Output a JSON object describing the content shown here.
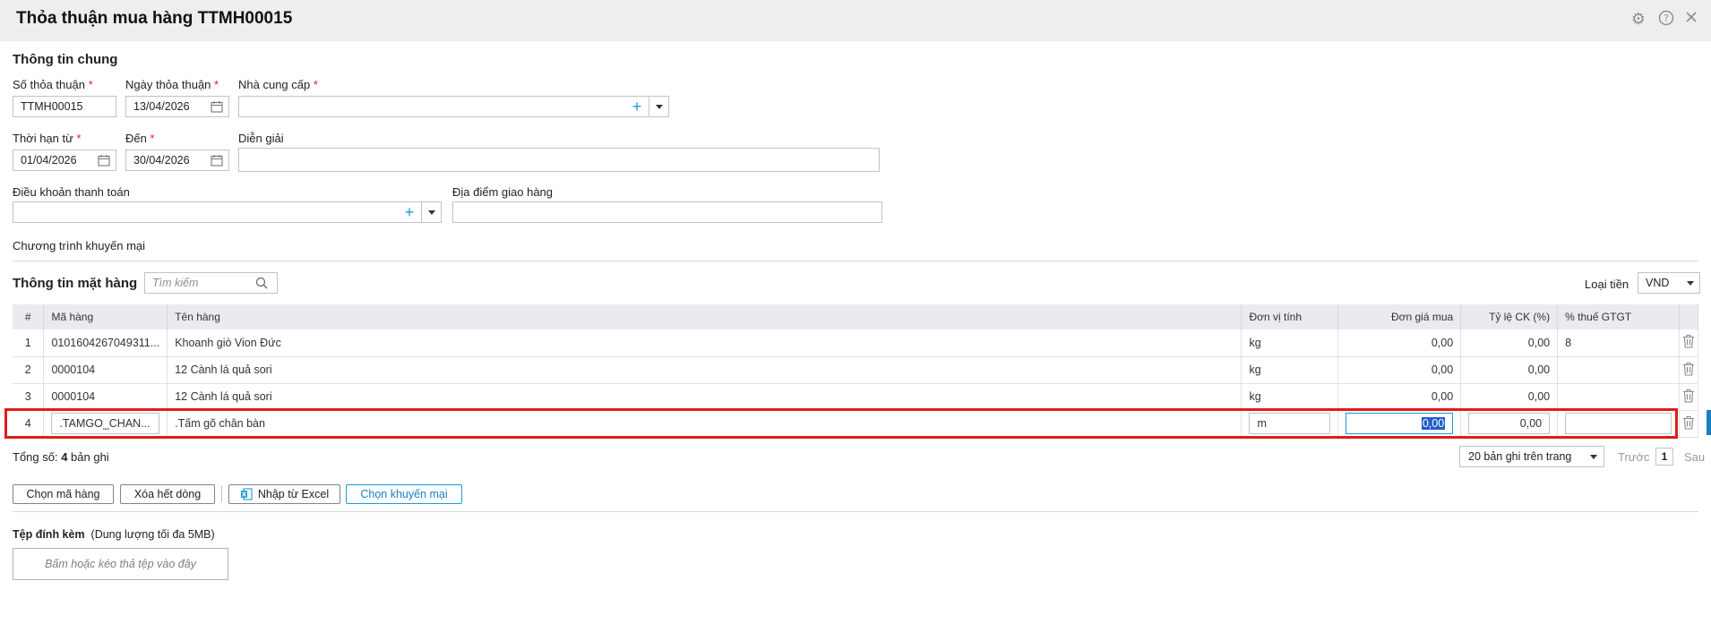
{
  "window": {
    "title": "Thỏa thuận mua hàng TTMH00015"
  },
  "general": {
    "section_title": "Thông tin chung",
    "agreement_no": {
      "label": "Số thỏa thuận",
      "value": "TTMH00015"
    },
    "agreement_date": {
      "label": "Ngày thỏa thuận",
      "value": "13/04/2026"
    },
    "supplier": {
      "label": "Nhà cung cấp",
      "value": ""
    },
    "period_from": {
      "label": "Thời hạn từ",
      "value": "01/04/2026"
    },
    "period_to": {
      "label": "Đến",
      "value": "30/04/2026"
    },
    "description": {
      "label": "Diễn giải",
      "value": ""
    },
    "payment_terms": {
      "label": "Điều khoản thanh toán",
      "value": ""
    },
    "delivery_place": {
      "label": "Địa điểm giao hàng",
      "value": ""
    },
    "promotion_label": "Chương trình khuyến mại"
  },
  "items": {
    "section_title": "Thông tin mặt hàng",
    "search_placeholder": "Tìm kiếm",
    "currency_label": "Loại tiền",
    "currency_value": "VND",
    "columns": [
      "#",
      "Mã hàng",
      "Tên hàng",
      "Đơn vị tính",
      "Đơn giá mua",
      "Tỷ lệ CK (%)",
      "% thuế GTGT"
    ],
    "rows": [
      {
        "no": "1",
        "code": "0101604267049311...",
        "name": "Khoanh giò Vion Đức",
        "unit": "kg",
        "price": "0,00",
        "discount": "0,00",
        "vat": "8"
      },
      {
        "no": "2",
        "code": "0000104",
        "name": "12 Cành lá quả sori",
        "unit": "kg",
        "price": "0,00",
        "discount": "0,00",
        "vat": ""
      },
      {
        "no": "3",
        "code": "0000104",
        "name": "12 Cành lá quả sori",
        "unit": "kg",
        "price": "0,00",
        "discount": "0,00",
        "vat": ""
      },
      {
        "no": "4",
        "code": ".TAMGO_CHAN...",
        "name": ".Tấm gõ chân bàn",
        "unit": "m",
        "price": "0,00",
        "discount": "0,00",
        "vat": ""
      }
    ],
    "total_prefix": "Tổng số: ",
    "total_count": "4",
    "total_suffix": " bản ghi",
    "page_size": "20 bản ghi trên trang",
    "prev_label": "Trước",
    "page_number": "1",
    "next_label": "Sau"
  },
  "actions": {
    "choose_item": "Chọn mã hàng",
    "delete_all": "Xóa hết dòng",
    "import_excel": "Nhập từ Excel",
    "choose_promo": "Chọn khuyến mại"
  },
  "attachments": {
    "title": "Tệp đính kèm",
    "hint": "(Dung lượng tối đa 5MB)",
    "dropzone": "Bấm hoặc kéo thả tệp vào đây"
  },
  "colors": {
    "accent": "#1a9bd7",
    "required": "#e02020",
    "highlight": "#e01c1c"
  }
}
